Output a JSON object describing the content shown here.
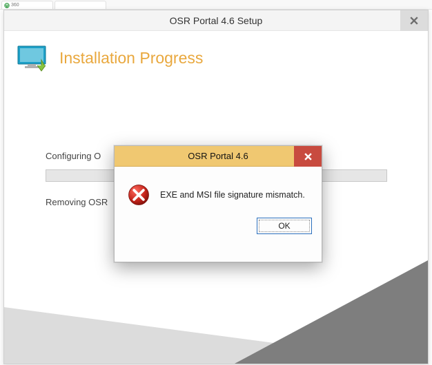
{
  "browser_tab": {
    "label": "360"
  },
  "setup_window": {
    "title": "OSR Portal 4.6 Setup",
    "heading": "Installation Progress",
    "status1": "Configuring O",
    "status2": "Removing OSR"
  },
  "error_dialog": {
    "title": "OSR Portal 4.6",
    "message": "EXE and MSI file signature mismatch.",
    "ok_label": "OK"
  }
}
